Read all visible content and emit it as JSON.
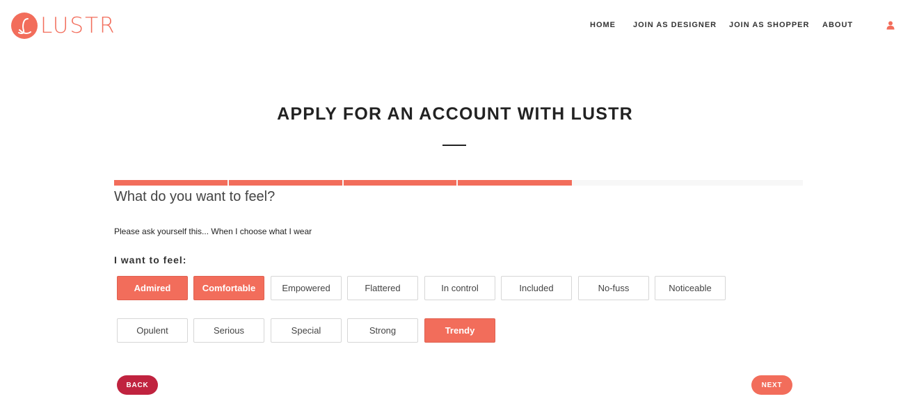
{
  "brand": {
    "name": "LUSTR",
    "color": "#f26d5b"
  },
  "nav": {
    "items": [
      "HOME",
      "JOIN AS DESIGNER",
      "JOIN AS SHOPPER",
      "ABOUT"
    ],
    "user_icon": "user-icon"
  },
  "page": {
    "title": "APPLY FOR AN ACCOUNT WITH LUSTR",
    "progress": {
      "completed_steps": 4,
      "total_steps": 6
    },
    "question": "What do you want to feel?",
    "prompt": "Please ask yourself this... When I choose what I wear",
    "feel_label": "I want to feel:",
    "options": [
      {
        "label": "Admired",
        "selected": true
      },
      {
        "label": "Comfortable",
        "selected": true
      },
      {
        "label": "Empowered",
        "selected": false
      },
      {
        "label": "Flattered",
        "selected": false
      },
      {
        "label": "In control",
        "selected": false
      },
      {
        "label": "Included",
        "selected": false
      },
      {
        "label": "No-fuss",
        "selected": false
      },
      {
        "label": "Noticeable",
        "selected": false
      },
      {
        "label": "Opulent",
        "selected": false
      },
      {
        "label": "Serious",
        "selected": false
      },
      {
        "label": "Special",
        "selected": false
      },
      {
        "label": "Strong",
        "selected": false
      },
      {
        "label": "Trendy",
        "selected": true
      }
    ]
  },
  "buttons": {
    "back": "BACK",
    "next": "NEXT"
  },
  "colors": {
    "accent": "#f26d5b",
    "back": "#c0233f"
  }
}
